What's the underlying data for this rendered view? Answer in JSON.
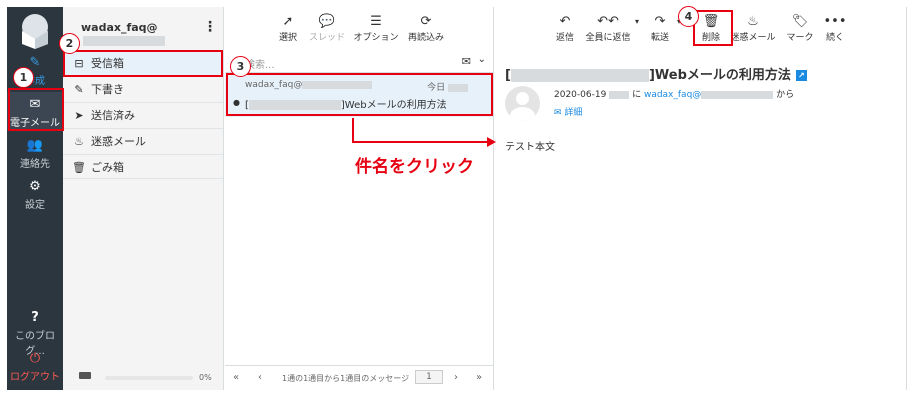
{
  "nav": {
    "compose_label": "作成",
    "mail_label": "電子メール",
    "contacts_label": "連絡先",
    "settings_label": "設定",
    "about_label": "このブログ...",
    "logout_label": "ログアウト"
  },
  "folders": {
    "account": "wadax_faq@",
    "items": [
      {
        "label": "受信箱",
        "icon": "inbox-icon"
      },
      {
        "label": "下書き",
        "icon": "pencil-icon"
      },
      {
        "label": "送信済み",
        "icon": "paper-plane-icon"
      },
      {
        "label": "迷惑メール",
        "icon": "fire-icon"
      },
      {
        "label": "ごみ箱",
        "icon": "trash-icon"
      }
    ],
    "quota_pct": "0%",
    "quota_fraction": 0
  },
  "list_toolbar": {
    "select": "選択",
    "thread": "スレッド",
    "options": "オプション",
    "refresh": "再読込み"
  },
  "search": {
    "placeholder": "検索..."
  },
  "message": {
    "from": "wadax_faq@",
    "date": "今日",
    "subject_suffix": "]Webメールの利用方法"
  },
  "pager": {
    "info": "1通の1通目から1通目のメッセージ",
    "page": "1"
  },
  "read_toolbar": {
    "reply": "返信",
    "reply_all": "全員に返信",
    "forward": "転送",
    "delete": "削除",
    "spam": "迷惑メール",
    "mark": "マーク",
    "more": "続く"
  },
  "reading": {
    "title_open": "[",
    "title_rest": "]Webメールの利用方法",
    "date": "2020-06-19",
    "ni": "に",
    "sender": "wadax_faq@",
    "kara": "から",
    "details": "詳細",
    "body": "テスト本文"
  },
  "annotations": {
    "step1": "1",
    "step2": "2",
    "step3": "3",
    "step4": "4",
    "callout": "件名をクリック"
  },
  "colors": {
    "nav_bg": "#2c363f",
    "accent": "#1a8be0",
    "annotation_red": "#e60012",
    "selected_bg": "#e7f1f9"
  }
}
